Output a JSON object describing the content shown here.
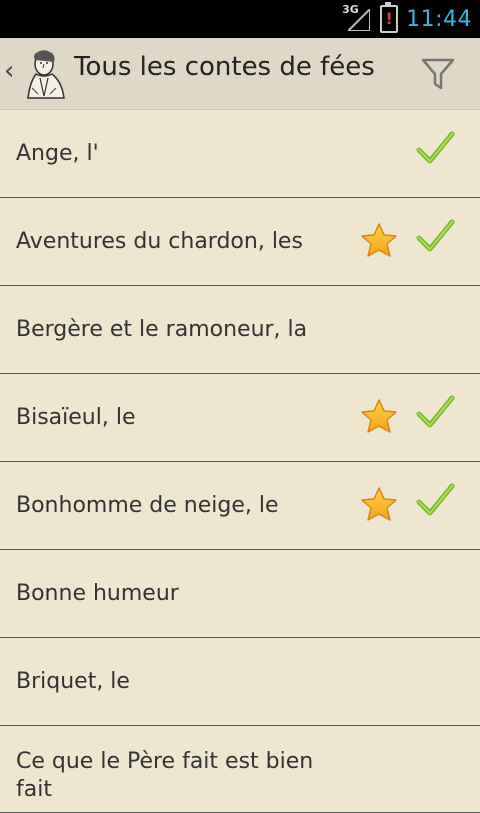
{
  "status": {
    "network": "3G",
    "time": "11:44"
  },
  "header": {
    "title": "Tous les contes de fées"
  },
  "colors": {
    "accent": "#33b5e5",
    "background": "#efe6cf",
    "star": "#f7a21b",
    "check": "#7cbc2a"
  },
  "items": [
    {
      "label": "Ange, l'",
      "favorite": false,
      "read": true
    },
    {
      "label": "Aventures du chardon, les",
      "favorite": true,
      "read": true
    },
    {
      "label": "Bergère et le ramoneur, la",
      "favorite": false,
      "read": false
    },
    {
      "label": "Bisaïeul, le",
      "favorite": true,
      "read": true
    },
    {
      "label": "Bonhomme de neige, le",
      "favorite": true,
      "read": true
    },
    {
      "label": "Bonne humeur",
      "favorite": false,
      "read": false
    },
    {
      "label": "Briquet, le",
      "favorite": false,
      "read": false
    },
    {
      "label": "Ce que le Père fait est bien fait",
      "favorite": false,
      "read": false
    }
  ]
}
